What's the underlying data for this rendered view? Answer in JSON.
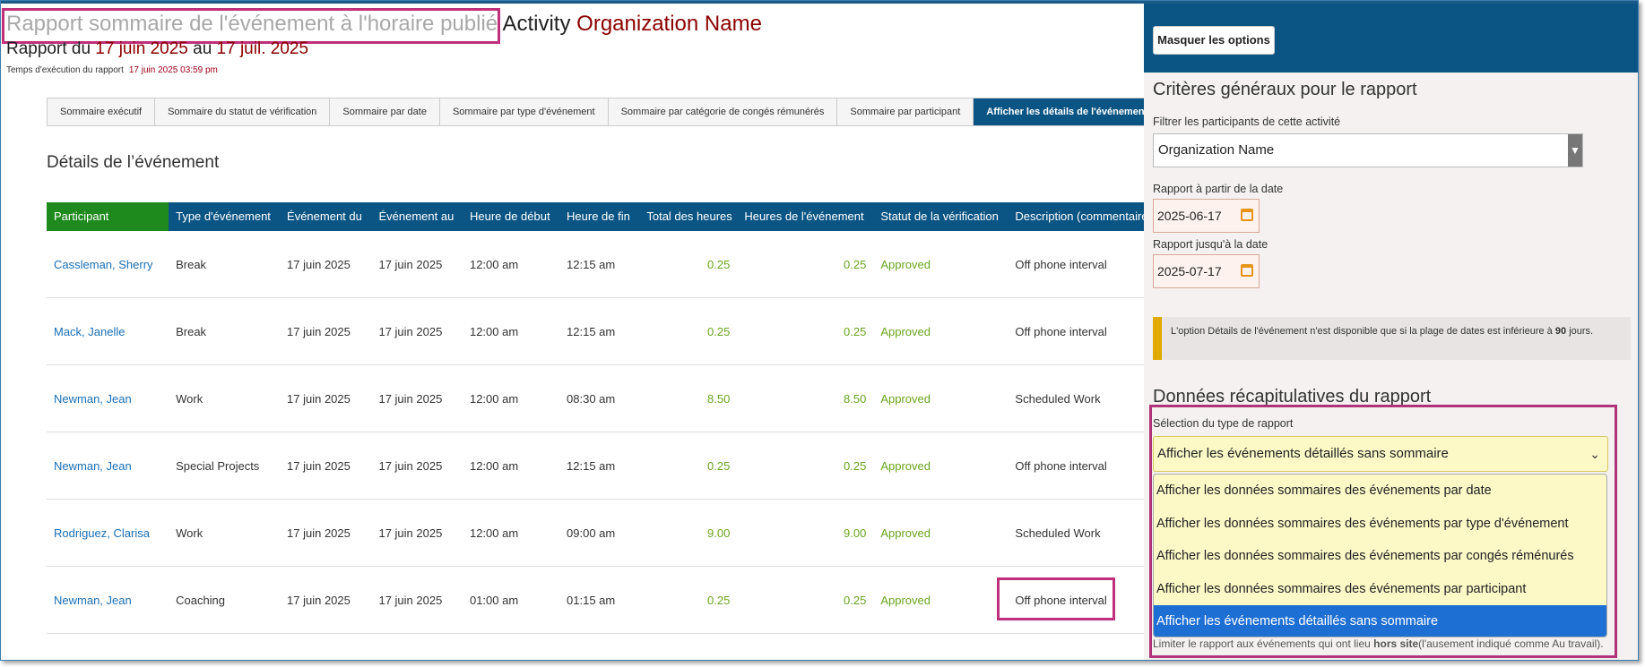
{
  "header": {
    "title_grey": "Rapport sommaire de l'événement à l'horaire publié",
    "title_activity": "Activity",
    "title_org": "Organization Name",
    "range_prefix": "Rapport du",
    "range_from": "17 juin 2025",
    "range_mid": "au",
    "range_to": "17 juil. 2025",
    "exec_label": "Temps d'exécution du rapport",
    "exec_time": "17 juin 2025 03:59 pm"
  },
  "tabs": [
    {
      "label": "Sommaire exécutif",
      "active": false
    },
    {
      "label": "Sommaire du statut de vérification",
      "active": false
    },
    {
      "label": "Sommaire par date",
      "active": false
    },
    {
      "label": "Sommaire par type d'événement",
      "active": false
    },
    {
      "label": "Sommaire par catégorie de congés rémunérés",
      "active": false
    },
    {
      "label": "Sommaire par participant",
      "active": false
    },
    {
      "label": "Afficher les détails de l'événement",
      "active": true
    }
  ],
  "section_title": "Détails de l’événement",
  "table": {
    "columns": [
      "Participant",
      "Type d'événement",
      "Événement du",
      "Événement au",
      "Heure de début",
      "Heure de fin",
      "Total des heures",
      "Heures de l'événement",
      "Statut de la vérification",
      "Description (commentaires)"
    ],
    "rows": [
      [
        "Cassleman, Sherry",
        "Break",
        "17 juin 2025",
        "17 juin 2025",
        "12:00 am",
        "12:15 am",
        "0.25",
        "0.25",
        "Approved",
        "Off phone interval"
      ],
      [
        "Mack, Janelle",
        "Break",
        "17 juin 2025",
        "17 juin 2025",
        "12:00 am",
        "12:15 am",
        "0.25",
        "0.25",
        "Approved",
        "Off phone interval"
      ],
      [
        "Newman, Jean",
        "Work",
        "17 juin 2025",
        "17 juin 2025",
        "12:00 am",
        "08:30 am",
        "8.50",
        "8.50",
        "Approved",
        "Scheduled Work"
      ],
      [
        "Newman, Jean",
        "Special Projects",
        "17 juin 2025",
        "17 juin 2025",
        "12:00 am",
        "12:15 am",
        "0.25",
        "0.25",
        "Approved",
        "Off phone interval"
      ],
      [
        "Rodriguez, Clarisa",
        "Work",
        "17 juin 2025",
        "17 juin 2025",
        "12:00 am",
        "09:00 am",
        "9.00",
        "9.00",
        "Approved",
        "Scheduled Work"
      ],
      [
        "Newman, Jean",
        "Coaching",
        "17 juin 2025",
        "17 juin 2025",
        "01:00 am",
        "01:15 am",
        "0.25",
        "0.25",
        "Approved",
        "Off phone interval"
      ]
    ]
  },
  "panel": {
    "hide_button": "Masquer les options",
    "general_title": "Critères généraux pour le rapport",
    "filter_label": "Filtrer les participants de cette activité",
    "filter_value": "Organization Name",
    "from_label": "Rapport à partir de la date",
    "from_value": "2025-06-17",
    "to_label": "Rapport jusqu'à la date",
    "to_value": "2025-07-17",
    "info_text": "L'option Détails de l'événement n'est disponible que si la plage de dates est inférieure à",
    "info_days": "90",
    "info_suffix": "jours.",
    "summary_title": "Données récapitulatives du rapport",
    "type_label": "Sélection du type de rapport",
    "type_value": "Afficher les événements détaillés sans sommaire",
    "options": [
      "Afficher les données sommaires des événements par date",
      "Afficher les données sommaires des événements par type d'événement",
      "Afficher les données sommaires des événements par congés réménurés",
      "Afficher les données sommaires des événements par participant",
      "Afficher les événements détaillés sans sommaire"
    ],
    "selected_option": 4,
    "under_text_1": "Limiter le rapport aux événements qui ont lieu",
    "under_text_bold": "hors site",
    "under_text_2": "(l'ausement indiqué comme Au travail)."
  },
  "colors": {
    "brand_blue": "#0b5584",
    "participant_header": "#1e8a1e",
    "approved_green": "#6aa51e",
    "highlight_magenta": "#c0307a",
    "dropdown_bg": "#fcf9c7",
    "selected_option": "#1e6fd4"
  }
}
